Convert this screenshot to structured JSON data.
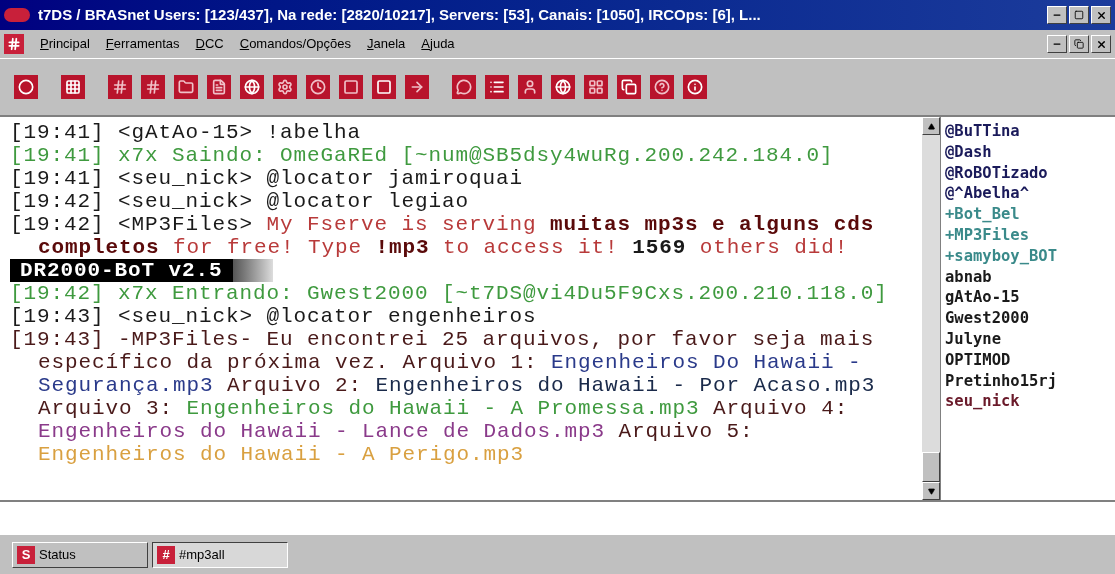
{
  "window": {
    "title": "t7DS  / BRASnet Users: [123/437], Na rede: [2820/10217], Servers: [53], Canais: [1050], IRCOps: [6], L..."
  },
  "menu": [
    "Principal",
    "Ferramentas",
    "DCC",
    "Comandos/Opções",
    "Janela",
    "Ajuda"
  ],
  "chat": [
    {
      "kind": "message",
      "segments": [
        {
          "text": "[19:41] <gAtAo-15> !abelha",
          "color": "#1a1a1a",
          "bold": false
        }
      ]
    },
    {
      "kind": "message",
      "segments": [
        {
          "text": "[19:41] x7x Saindo: OmeGaREd [~num@SB5dsy4wuRg.200.242.184.0]",
          "color": "#3f9a3f",
          "bold": false
        }
      ]
    },
    {
      "kind": "message",
      "segments": [
        {
          "text": "[19:41] <seu_nick> @locator jamiroquai",
          "color": "#1a1a1a",
          "bold": false
        }
      ]
    },
    {
      "kind": "message",
      "segments": [
        {
          "text": "[19:42] <seu_nick> @locator legiao",
          "color": "#1a1a1a",
          "bold": false
        }
      ]
    },
    {
      "kind": "message",
      "segments": [
        {
          "text": "[19:42] <MP3Files> ",
          "color": "#1a1a1a",
          "bold": false
        },
        {
          "text": "My Fserve is serving ",
          "color": "#b83a3a",
          "bold": false
        },
        {
          "text": "muitas mp3s e alguns cds completos",
          "color": "#5a0a0a",
          "bold": true
        },
        {
          "text": " for free! Type ",
          "color": "#b83a3a",
          "bold": false
        },
        {
          "text": "!mp3",
          "color": "#5a0a0a",
          "bold": true
        },
        {
          "text": " to access it! ",
          "color": "#b83a3a",
          "bold": false
        },
        {
          "text": "1569",
          "color": "#1a1a1a",
          "bold": true
        },
        {
          "text": " others did!",
          "color": "#b83a3a",
          "bold": false
        }
      ]
    },
    {
      "kind": "banner",
      "segments": [
        {
          "text": "DR2000-BoT v2.5",
          "bold": true
        }
      ]
    },
    {
      "kind": "message",
      "segments": [
        {
          "text": "[19:42] x7x Entrando: Gwest2000 [~t7DS@vi4Du5F9Cxs.200.210.118.0]",
          "color": "#3f9a3f",
          "bold": false
        }
      ]
    },
    {
      "kind": "message",
      "segments": [
        {
          "text": "[19:43] <seu_nick> @locator engenheiros",
          "color": "#1a1a1a",
          "bold": false
        }
      ]
    },
    {
      "kind": "message",
      "segments": [
        {
          "text": "[19:43] -MP3Files- Eu encontrei 25 arquivos, por favor seja mais específico da próxima vez. Arquivo 1: ",
          "color": "#4a1a1a",
          "bold": false
        },
        {
          "text": "Engenheiros Do Hawaii - Segurança.mp3",
          "color": "#2a3a8a",
          "bold": false
        },
        {
          "text": " Arquivo 2: ",
          "color": "#4a1a1a",
          "bold": false
        },
        {
          "text": "Engenheiros do Hawaii - Por Acaso.mp3",
          "color": "#1a2a4a",
          "bold": false
        },
        {
          "text": " Arquivo 3: ",
          "color": "#4a1a1a",
          "bold": false
        },
        {
          "text": "Engenheiros do Hawaii - A Promessa.mp3",
          "color": "#3f9a3f",
          "bold": false
        },
        {
          "text": " Arquivo 4: ",
          "color": "#4a1a1a",
          "bold": false
        },
        {
          "text": "Engenheiros do Hawaii - Lance de Dados.mp3",
          "color": "#8a3a8a",
          "bold": false
        },
        {
          "text": " Arquivo 5: ",
          "color": "#4a1a1a",
          "bold": false
        },
        {
          "text": "Engenheiros do Hawaii - A Perigo.mp3",
          "color": "#d9a040",
          "bold": false
        }
      ]
    }
  ],
  "nicklist": [
    {
      "name": "@BuTTina",
      "color": "#1a1a5a"
    },
    {
      "name": "@Dash",
      "color": "#1a1a5a"
    },
    {
      "name": "@RoBOTizado",
      "color": "#1a1a5a"
    },
    {
      "name": "@^Abelha^",
      "color": "#1a1a5a"
    },
    {
      "name": "+Bot_Bel",
      "color": "#3a8a8a"
    },
    {
      "name": "+MP3Files",
      "color": "#3a8a8a"
    },
    {
      "name": "+samyboy_BOT",
      "color": "#3a8a8a"
    },
    {
      "name": "abnab",
      "color": "#1a1a1a"
    },
    {
      "name": "gAtAo-15",
      "color": "#1a1a1a"
    },
    {
      "name": "Gwest2000",
      "color": "#1a1a1a"
    },
    {
      "name": "Julyne",
      "color": "#1a1a1a"
    },
    {
      "name": "OPTIMOD",
      "color": "#1a1a1a"
    },
    {
      "name": "Pretinho15rj",
      "color": "#1a1a1a"
    },
    {
      "name": "seu_nick",
      "color": "#6a1a2a"
    }
  ],
  "switchbar": [
    {
      "label": "Status",
      "icon": "S",
      "selected": false
    },
    {
      "label": "#mp3all",
      "icon": "#",
      "selected": true
    }
  ]
}
